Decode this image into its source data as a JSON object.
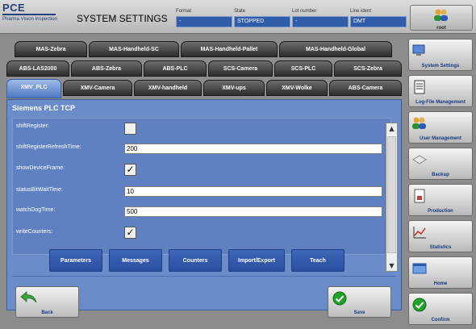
{
  "header": {
    "logo_main": "PCE",
    "logo_sub": "Pharma Vision Inspection",
    "app_title": "SYSTEM SETTINGS",
    "fields": [
      {
        "label": "Format",
        "value": "-"
      },
      {
        "label": "State",
        "value": "STOPPED"
      },
      {
        "label": "Lot number",
        "value": "-"
      },
      {
        "label": "Line ident",
        "value": "DMT"
      }
    ],
    "user": "root"
  },
  "tabs": {
    "row1": [
      "MAS-Zebra",
      "MAS-Handheld-SC",
      "MAS-Handheld-Pallet",
      "MAS-Handheld-Global"
    ],
    "row2": [
      "ABS-LAS2000",
      "ABS-Zebra",
      "ABS-PLC",
      "SCS-Camera",
      "SCS-PLC",
      "SCS-Zebra"
    ],
    "row3": [
      "XMV_PLC",
      "XMV-Camera",
      "XMV-handheld",
      "XMV-ups",
      "XMV-Wolke",
      "ABS-Camera"
    ]
  },
  "panel": {
    "title": "Siemens PLC TCP",
    "rows": [
      {
        "label": "shiftRegister:",
        "type": "checkbox",
        "checked": false,
        "value": ""
      },
      {
        "label": "shiftRegisterRefreshTime:",
        "type": "text",
        "value": "200"
      },
      {
        "label": "showDeviceFrame:",
        "type": "checkbox",
        "checked": true,
        "value": "✓"
      },
      {
        "label": "statusBitWaitTime:",
        "type": "text",
        "value": "10"
      },
      {
        "label": "watchDogTime:",
        "type": "text",
        "value": "500"
      },
      {
        "label": "writeCounters:",
        "type": "checkbox",
        "checked": true,
        "value": "✓"
      }
    ],
    "buttons": [
      "Parameters",
      "Messages",
      "Counters",
      "Import/Export",
      "Teach"
    ],
    "back_label": "Back",
    "save_label": "Save"
  },
  "sidebar": {
    "items": [
      "System Settings",
      "Log-File Management",
      "User Management",
      "Backup",
      "Production",
      "Statistics",
      "Home",
      "Confirm"
    ]
  },
  "colors": {
    "panel_blue": "#6a8cc9",
    "button_blue": "#2f55a5",
    "tab_dark": "#3a3a3a",
    "confirm_green": "#23a12e"
  }
}
